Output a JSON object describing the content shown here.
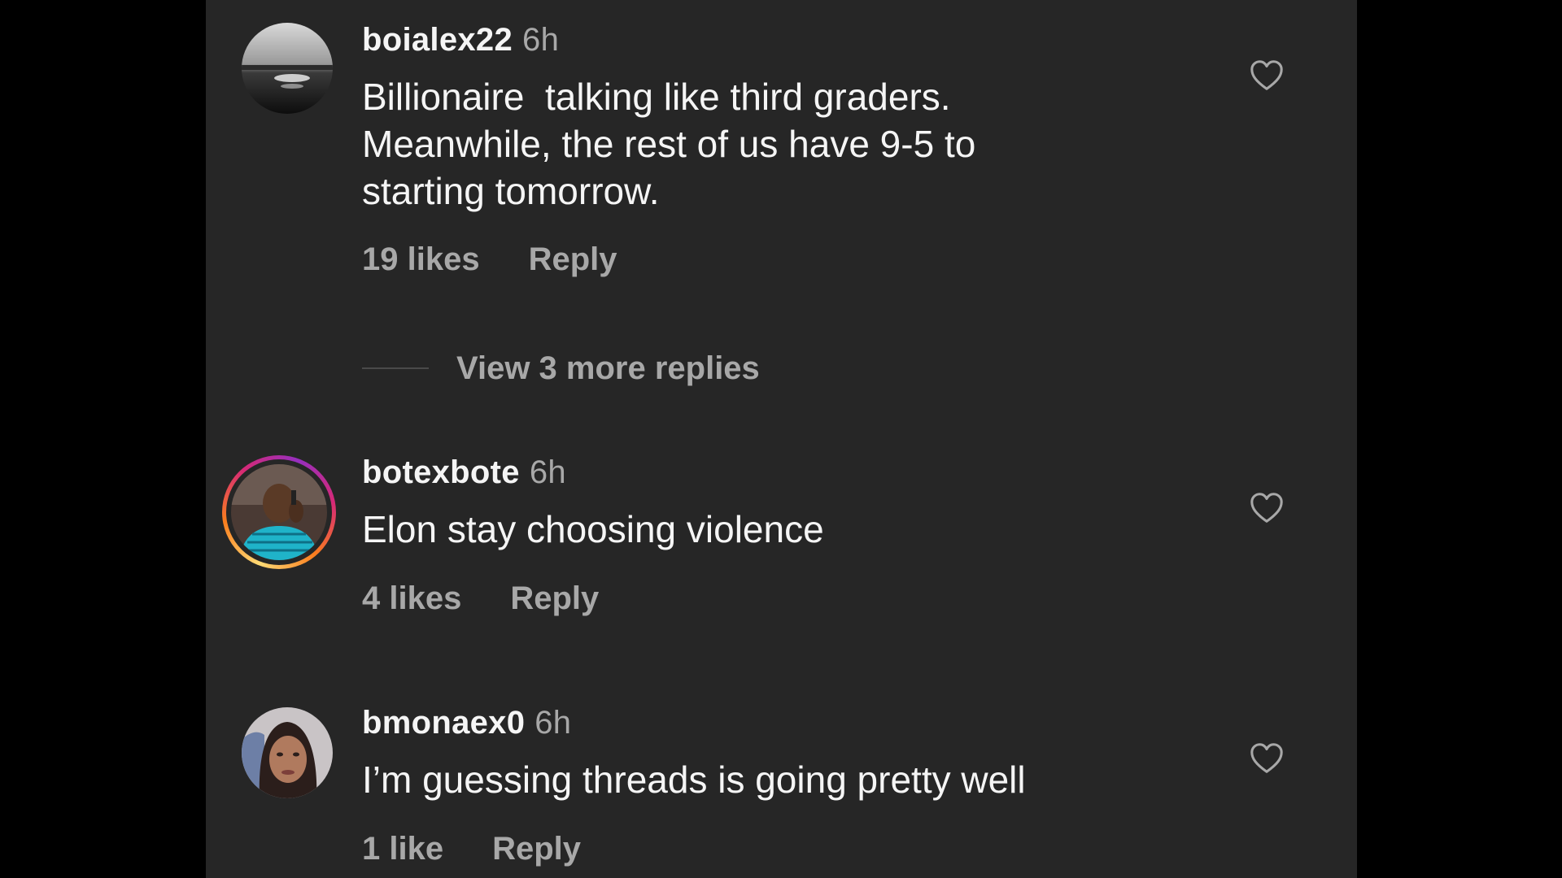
{
  "colors": {
    "background": "#000000",
    "panel": "#262626",
    "primary_text": "#f5f5f5",
    "secondary_text": "#a8a8a8"
  },
  "comments": [
    {
      "username": "boialex22",
      "time": "6h",
      "text": "Billionaire  talking like third graders.\nMeanwhile, the rest of us have 9-5 to\nstarting tomorrow.",
      "likes": "19 likes",
      "reply_label": "Reply",
      "has_story_ring": false,
      "like_icon": "heart-outline-icon"
    },
    {
      "username": "botexbote",
      "time": "6h",
      "text": "Elon stay choosing violence",
      "likes": "4 likes",
      "reply_label": "Reply",
      "has_story_ring": true,
      "like_icon": "heart-outline-icon"
    },
    {
      "username": "bmonaex0",
      "time": "6h",
      "text": "I’m guessing threads is going pretty well",
      "likes": "1 like",
      "reply_label": "Reply",
      "has_story_ring": false,
      "like_icon": "heart-outline-icon"
    }
  ],
  "view_replies": {
    "label": "View 3 more replies"
  }
}
